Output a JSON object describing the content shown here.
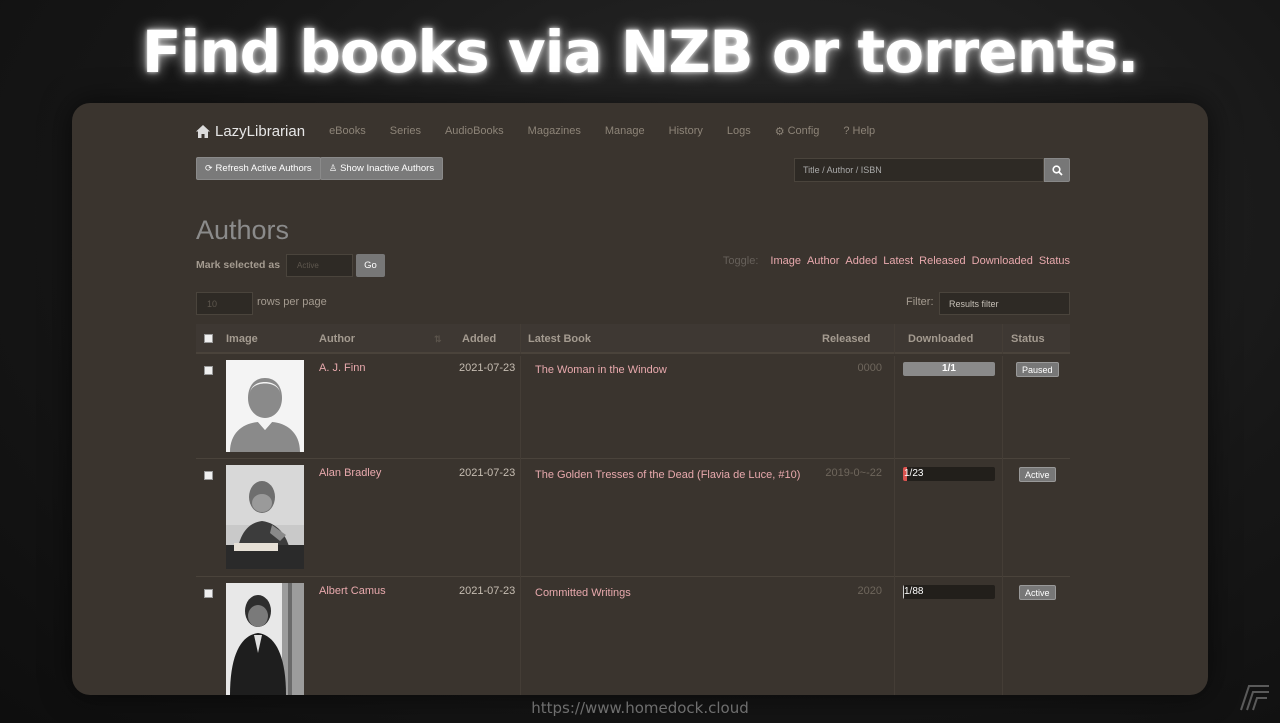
{
  "headline": "Find books via NZB or torrents.",
  "footer_url": "https://www.homedock.cloud",
  "app": {
    "brand": "LazyLibrarian",
    "nav": [
      {
        "label": "eBooks",
        "icon": ""
      },
      {
        "label": "Series",
        "icon": ""
      },
      {
        "label": "AudioBooks",
        "icon": ""
      },
      {
        "label": "Magazines",
        "icon": ""
      },
      {
        "label": "Manage",
        "icon": ""
      },
      {
        "label": "History",
        "icon": ""
      },
      {
        "label": "Logs",
        "icon": ""
      },
      {
        "label": "Config",
        "icon": "gear-icon"
      },
      {
        "label": "Help",
        "icon": "question-icon"
      }
    ],
    "refresh_label": "Refresh Active Authors",
    "inactive_label": "Show Inactive Authors",
    "search_placeholder": "Title / Author / ISBN",
    "page_title": "Authors",
    "mark_label": "Mark selected as",
    "mark_value": "Active",
    "go_label": "Go",
    "toggle_label": "Toggle:",
    "toggles": [
      "Image",
      "Author",
      "Added",
      "Latest",
      "Released",
      "Downloaded",
      "Status"
    ],
    "rows_value": "10",
    "rows_label": "rows per page",
    "filter_label": "Filter:",
    "filter_placeholder": "Results filter",
    "columns": {
      "image": "Image",
      "author": "Author",
      "added": "Added",
      "latest": "Latest Book",
      "released": "Released",
      "downloaded": "Downloaded",
      "status": "Status"
    },
    "rows": [
      {
        "author": "A. J. Finn",
        "added": "2021-07-23",
        "book": "The Woman in the Window",
        "released": "0000",
        "downloaded": "1/1",
        "progress": 1.0,
        "status": "Paused"
      },
      {
        "author": "Alan Bradley",
        "added": "2021-07-23",
        "book": "The Golden Tresses of the Dead (Flavia de Luce, #10)",
        "released": "2019-0~-22",
        "downloaded": "1/23",
        "progress": 0.043,
        "status": "Active"
      },
      {
        "author": "Albert Camus",
        "added": "2021-07-23",
        "book": "Committed Writings",
        "released": "2020",
        "downloaded": "1/88",
        "progress": 0.011,
        "status": "Active"
      }
    ]
  }
}
